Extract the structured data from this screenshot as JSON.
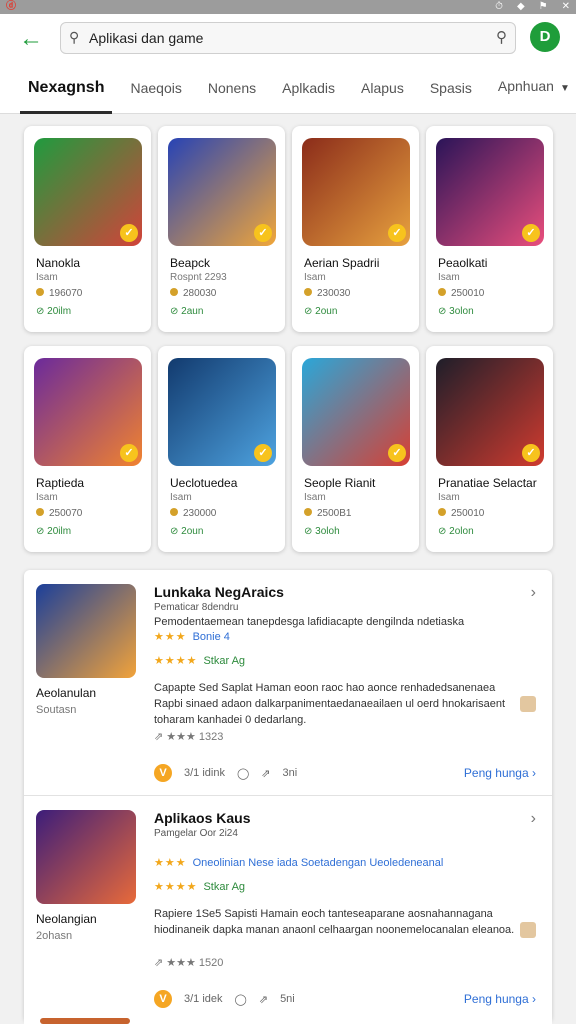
{
  "status": {
    "left": "ⓓ",
    "right_icons": [
      "⏱",
      "◆",
      "⚑",
      "✕"
    ]
  },
  "search": {
    "value": "Aplikasi dan game"
  },
  "tabs": [
    {
      "label": "Nexagnsh",
      "active": true
    },
    {
      "label": "Naeqois"
    },
    {
      "label": "Nonens"
    },
    {
      "label": "Aplkadis"
    },
    {
      "label": "Alapus"
    },
    {
      "label": "Spasis"
    },
    {
      "label": "Apnhuan"
    }
  ],
  "grid": [
    {
      "name": "Nanokla",
      "dev": "Isam",
      "downloads": "196070",
      "size": "20ilm",
      "colors": [
        "#1f9b3e",
        "#d2433a"
      ],
      "badge": "✓"
    },
    {
      "name": "Beapck",
      "dev": "Rospnt 2293",
      "downloads": "280030",
      "size": "2aun",
      "colors": [
        "#2743b5",
        "#f0a63a"
      ],
      "badge": "✓"
    },
    {
      "name": "Aerian Spadrii",
      "dev": "Isam",
      "downloads": "230030",
      "size": "2oun",
      "colors": [
        "#8b2c1a",
        "#e7a13f"
      ],
      "badge": "✓"
    },
    {
      "name": "Peaolkati",
      "dev": "Isam",
      "downloads": "250010",
      "size": "3olon",
      "colors": [
        "#2a1458",
        "#e94e7c"
      ],
      "badge": "✓"
    },
    {
      "name": "Raptieda",
      "dev": "Isam",
      "downloads": "250070",
      "size": "20ilm",
      "colors": [
        "#6b2a9b",
        "#f1832f"
      ],
      "badge": "✓"
    },
    {
      "name": "Ueclotuedea",
      "dev": "Isam",
      "downloads": "230000",
      "size": "2oun",
      "colors": [
        "#123a6e",
        "#4ea3e0"
      ],
      "badge": "✓"
    },
    {
      "name": "Seople Rianit",
      "dev": "Isam",
      "downloads": "2500B1",
      "size": "3oloh",
      "colors": [
        "#2aa7d9",
        "#d83f33"
      ],
      "badge": "✓"
    },
    {
      "name": "Pranatiae Selactar",
      "dev": "Isam",
      "downloads": "250010",
      "size": "2olon",
      "colors": [
        "#1e1e2a",
        "#d03b2f"
      ],
      "badge": "✓"
    }
  ],
  "list": [
    {
      "title": "Lunkaka NegAraics",
      "sub": "Pematicar 8dendru",
      "line": "Pemodentaemean tanepdesga lafidiacapte dengilnda ndetiaska",
      "tagline_stars": "★★★",
      "tagline": "Bonie 4",
      "rate_stars": "★★★★",
      "rate": "Stkar Ag",
      "desc": "Capapte Sed Saplat Haman eoon raoc hao aonce renhadedsanenaea Rapbi sinaed adaon dalkarpanimentaedanaeailaen ul oerd hnokarisaent toharam kanhadei 0 dedarlang.",
      "mini": "1323",
      "coins": "3/1 idink",
      "chat": "3ni",
      "more": "Peng hunga",
      "side_name": "Aeolanulan",
      "side_sub": "Soutasn",
      "colors": [
        "#1b3f9a",
        "#f2a33a"
      ]
    },
    {
      "title": "Aplikaos Kaus",
      "sub": "Pamgelar Oor 2i24",
      "line": "",
      "tagline_stars": "★★★",
      "tagline": "Oneolinian Nese iada Soetadengan Ueoledeneanal",
      "rate_stars": "★★★★",
      "rate": "Stkar Ag",
      "desc": "Rapiere 1Se5 Sapisti Hamain eoch tanteseaparane aosnahannagana hiodinaneik dapka manan anaonl celhaargan noonemelocanalan eleanoa.",
      "mini": "1520",
      "coins": "3/1 idek",
      "chat": "5ni",
      "more": "Peng hunga",
      "side_name": "Neolangian",
      "side_sub": "2ohasn",
      "colors": [
        "#3c1d7a",
        "#e86a3a"
      ]
    }
  ]
}
